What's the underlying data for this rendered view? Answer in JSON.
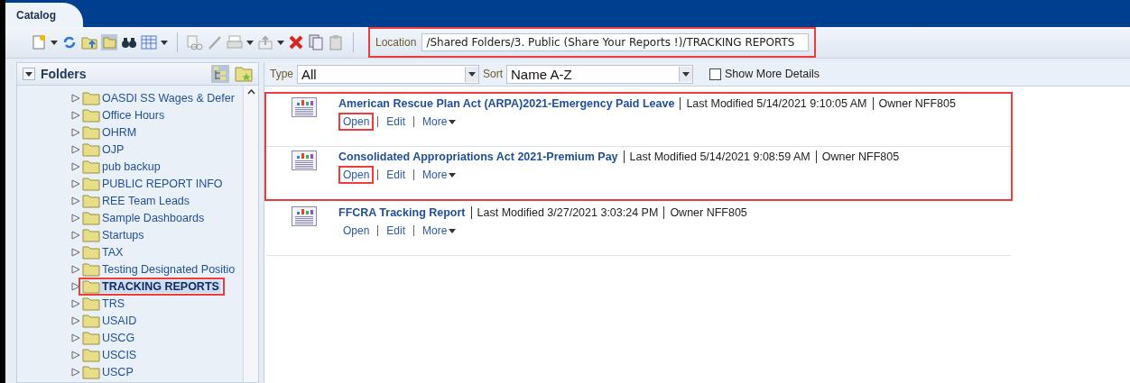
{
  "header": {
    "tab": "Catalog"
  },
  "location": {
    "label": "Location",
    "value": "/Shared Folders/3. Public (Share Your Reports !)/TRACKING REPORTS",
    "highlighted": true
  },
  "folders": {
    "title": "Folders",
    "items": [
      {
        "label": "OASDI SS Wages & Defer",
        "selected": false,
        "highlighted": false
      },
      {
        "label": "Office Hours",
        "selected": false,
        "highlighted": false
      },
      {
        "label": "OHRM",
        "selected": false,
        "highlighted": false
      },
      {
        "label": "OJP",
        "selected": false,
        "highlighted": false
      },
      {
        "label": "pub backup",
        "selected": false,
        "highlighted": false
      },
      {
        "label": "PUBLIC REPORT INFO",
        "selected": false,
        "highlighted": false
      },
      {
        "label": "REE Team Leads",
        "selected": false,
        "highlighted": false
      },
      {
        "label": "Sample Dashboards",
        "selected": false,
        "highlighted": false
      },
      {
        "label": "Startups",
        "selected": false,
        "highlighted": false
      },
      {
        "label": "TAX",
        "selected": false,
        "highlighted": false
      },
      {
        "label": "Testing Designated Positio",
        "selected": false,
        "highlighted": false
      },
      {
        "label": "TRACKING REPORTS",
        "selected": true,
        "highlighted": true
      },
      {
        "label": "TRS",
        "selected": false,
        "highlighted": false
      },
      {
        "label": "USAID",
        "selected": false,
        "highlighted": false
      },
      {
        "label": "USCG",
        "selected": false,
        "highlighted": false
      },
      {
        "label": "USCIS",
        "selected": false,
        "highlighted": false
      },
      {
        "label": "USCP",
        "selected": false,
        "highlighted": false
      }
    ]
  },
  "filters": {
    "type_label": "Type",
    "type_value": "All",
    "sort_label": "Sort",
    "sort_value": "Name A-Z",
    "show_more_details": {
      "label": "Show More Details",
      "checked": false
    }
  },
  "items": [
    {
      "name": "American Rescue Plan Act (ARPA)2021-Emergency Paid Leave",
      "modified": "Last Modified 5/14/2021 9:10:05 AM",
      "owner": "Owner NFF805",
      "actions": [
        "Open",
        "Edit",
        "More"
      ],
      "highlighted": true,
      "open_highlighted": true
    },
    {
      "name": "Consolidated Appropriations Act 2021-Premium Pay",
      "modified": "Last Modified 5/14/2021 9:08:59 AM",
      "owner": "Owner NFF805",
      "actions": [
        "Open",
        "Edit",
        "More"
      ],
      "highlighted": true,
      "open_highlighted": true
    },
    {
      "name": "FFCRA Tracking Report",
      "modified": "Last Modified 3/27/2021 3:03:24 PM",
      "owner": "Owner NFF805",
      "actions": [
        "Open",
        "Edit",
        "More"
      ],
      "highlighted": false,
      "open_highlighted": false
    }
  ]
}
